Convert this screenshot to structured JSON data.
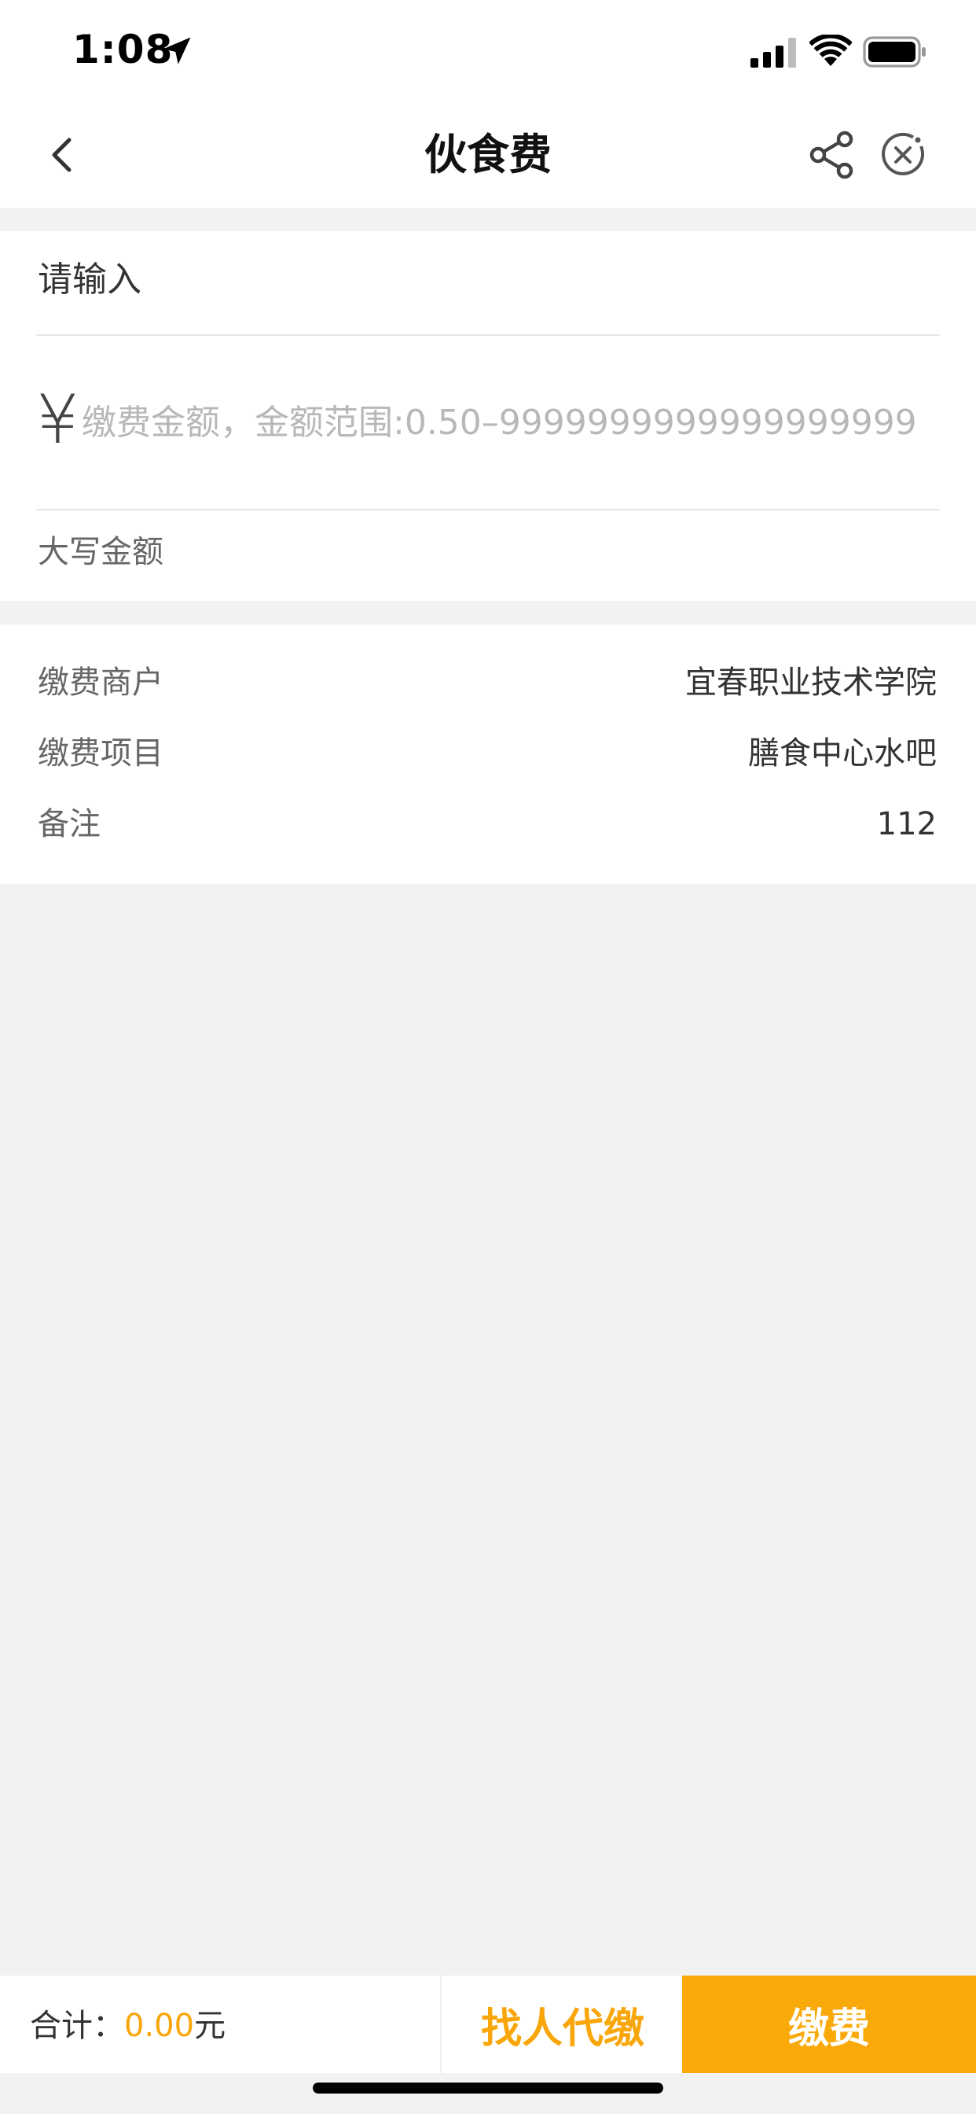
{
  "status_bar": {
    "time": "1:08"
  },
  "nav": {
    "title": "伙食费"
  },
  "form": {
    "input_label": "请输入",
    "currency_symbol": "¥",
    "amount_value": "",
    "amount_placeholder": "缴费金额，金额范围:0.50–9999999999999999999",
    "uppercase_label": "大写金额"
  },
  "info": [
    {
      "key": "缴费商户",
      "value": "宜春职业技术学院"
    },
    {
      "key": "缴费项目",
      "value": "膳食中心水吧"
    },
    {
      "key": "备注",
      "value": "112"
    }
  ],
  "footer": {
    "total_label": "合计：",
    "total_value": "0.00",
    "total_unit": "元",
    "proxy_button": "找人代缴",
    "pay_button": "缴费"
  },
  "colors": {
    "accent": "#f9a90a",
    "background": "#f2f2f2"
  }
}
